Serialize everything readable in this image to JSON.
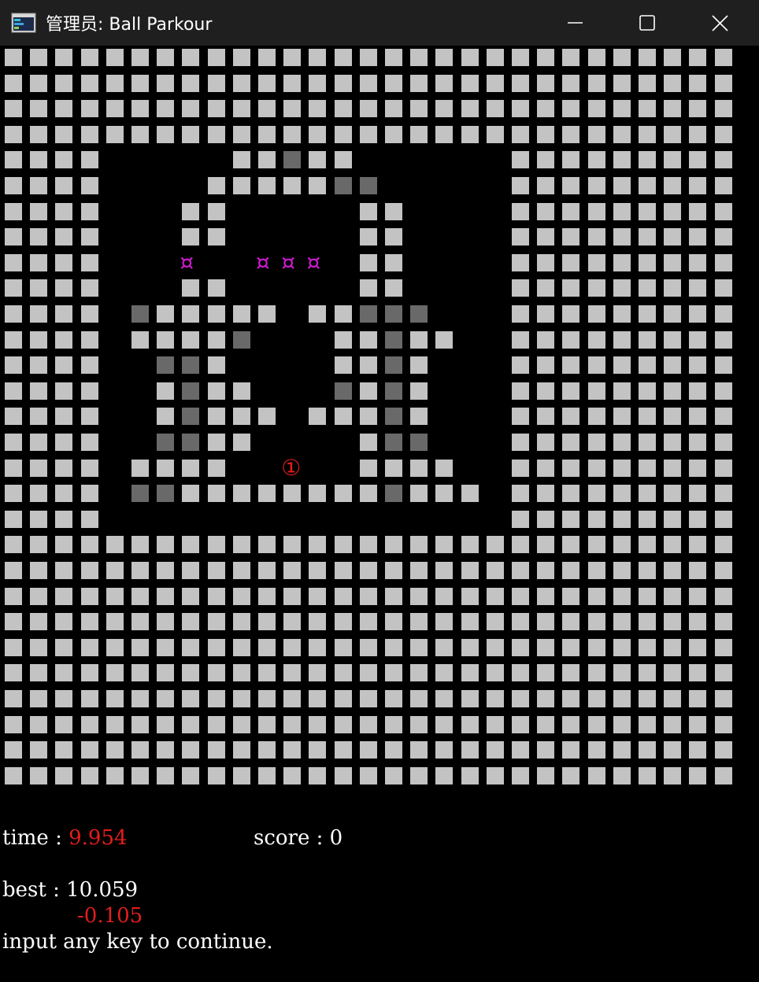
{
  "window": {
    "title": "管理员:  Ball Parkour",
    "minimize_icon": "minimize-icon",
    "maximize_icon": "maximize-icon",
    "close_icon": "close-icon"
  },
  "colors": {
    "block_light": "#c3c3c3",
    "block_dark": "#696969",
    "coin": "#d11ad1",
    "ball": "#e31d1d",
    "text": "#ffffff",
    "highlight": "#e31d1d"
  },
  "board": {
    "columns": 29,
    "rows": 29,
    "legend": {
      "#": "light-block",
      "D": "dark-block",
      ".": "empty",
      "C": "coin",
      "B": "ball"
    },
    "grid": [
      "#############################",
      "#############################",
      "#############################",
      "#############################",
      "####.....##D##......#########",
      "####....#####DD.....#########",
      "####...##.....##....#########",
      "####...##.....##....#########",
      "####...C..CCC.##....#########",
      "####...##.....##....#########",
      "####.D#####.##DDD...#########",
      "####.####D...##D##..#########",
      "####..DD#....##D#...#########",
      "####..#D##...D#D#...#########",
      "####..#D###.###D#...#########",
      "####..DD##....#DD...#########",
      "####.####..B..####..#########",
      "####.DD########D###.#########",
      "####................#########",
      "#############################",
      "#############################",
      "#############################",
      "#############################",
      "#############################",
      "#############################",
      "#############################",
      "#############################",
      "#############################",
      "#############################"
    ],
    "coin_glyph": "¤",
    "ball_glyph": "①"
  },
  "hud": {
    "time_label": "time : ",
    "time_value": "9.954",
    "score_label": "score : ",
    "score_value": "0",
    "best_label": "best : ",
    "best_value": "10.059",
    "diff_value": "-0.105",
    "prompt": "input any key to continue."
  }
}
